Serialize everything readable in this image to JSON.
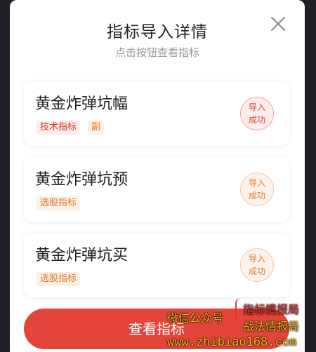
{
  "modal": {
    "title": "指标导入详情",
    "subtitle": "点击按钮查看指标"
  },
  "indicators": [
    {
      "name": "黄金炸弹坑幅",
      "tags": [
        "技术指标",
        "副"
      ],
      "status_line1": "导入",
      "status_line2": "成功",
      "status_color": "#d6453a"
    },
    {
      "name": "黄金炸弹坑预",
      "tags": [
        "选股指标"
      ],
      "status_line1": "导入",
      "status_line2": "成功",
      "status_color": "#e07a2c"
    },
    {
      "name": "黄金炸弹坑买",
      "tags": [
        "选股指标"
      ],
      "status_line1": "导入",
      "status_line2": "成功",
      "status_color": "#e07a2c"
    }
  ],
  "primary_button": "查看指标",
  "watermark": {
    "account": "微信公众号",
    "line1": "指标情报局",
    "line2": "战法情报局",
    "url": "www.zhibiao168.com"
  },
  "colors": {
    "accent": "#e3453b",
    "tag_red": "#d63a2a",
    "tag_orange": "#e07a2c"
  }
}
